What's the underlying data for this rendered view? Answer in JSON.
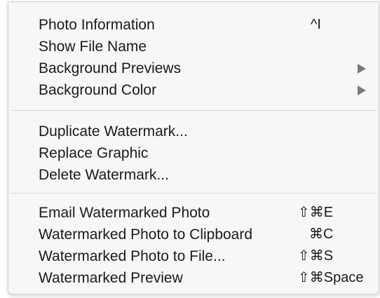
{
  "menu": {
    "section1": [
      {
        "label": "Photo Information",
        "shortcut": "^I",
        "submenu": false
      },
      {
        "label": "Show File Name",
        "shortcut": "",
        "submenu": false
      },
      {
        "label": "Background Previews",
        "shortcut": "",
        "submenu": true
      },
      {
        "label": "Background Color",
        "shortcut": "",
        "submenu": true
      }
    ],
    "section2": [
      {
        "label": "Duplicate Watermark..."
      },
      {
        "label": "Replace Graphic"
      },
      {
        "label": "Delete Watermark..."
      }
    ],
    "section3": [
      {
        "label": "Email Watermarked Photo",
        "shortcut": "⇧⌘E"
      },
      {
        "label": "Watermarked Photo to Clipboard",
        "shortcut": "⌘C"
      },
      {
        "label": "Watermarked Photo to File...",
        "shortcut": "⇧⌘S"
      },
      {
        "label": "Watermarked Preview",
        "shortcut": "⇧⌘Space"
      }
    ]
  },
  "icons": {
    "submenu_arrow": "submenu-arrow-icon"
  },
  "colors": {
    "menu_background": "#f7f7f7",
    "separator": "#d9d9d9",
    "arrow": "#7a7a7a"
  }
}
